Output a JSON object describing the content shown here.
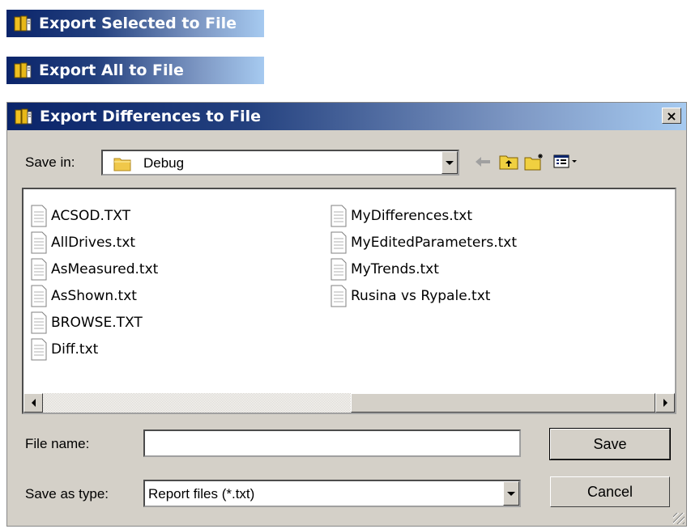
{
  "windows": [
    {
      "title": "Export Selected to File",
      "icon": "export-icon"
    },
    {
      "title": "Export All to File",
      "icon": "export-icon"
    }
  ],
  "dialog": {
    "title": "Export Differences to File",
    "close_label": "×",
    "save_in": {
      "label": "Save in:",
      "value": "Debug",
      "icon": "folder-icon"
    },
    "toolbar": [
      "back-arrow-icon",
      "up-one-level-icon",
      "create-new-folder-icon",
      "view-menu-icon"
    ],
    "files": {
      "column1": [
        "ACSOD.TXT",
        "AllDrives.txt",
        "AsMeasured.txt",
        "AsShown.txt",
        "BROWSE.TXT",
        "Diff.txt"
      ],
      "column2": [
        "MyDifferences.txt",
        "MyEditedParameters.txt",
        "MyTrends.txt",
        "Rusina vs Rypale.txt"
      ]
    },
    "file_name": {
      "label": "File name:",
      "value": ""
    },
    "save_as_type": {
      "label": "Save as type:",
      "value": "Report files (*.txt)"
    },
    "buttons": {
      "save": "Save",
      "cancel": "Cancel"
    }
  },
  "colors": {
    "title_start": "#0a246a",
    "title_end": "#a6caf0",
    "face": "#d4d0c8"
  }
}
